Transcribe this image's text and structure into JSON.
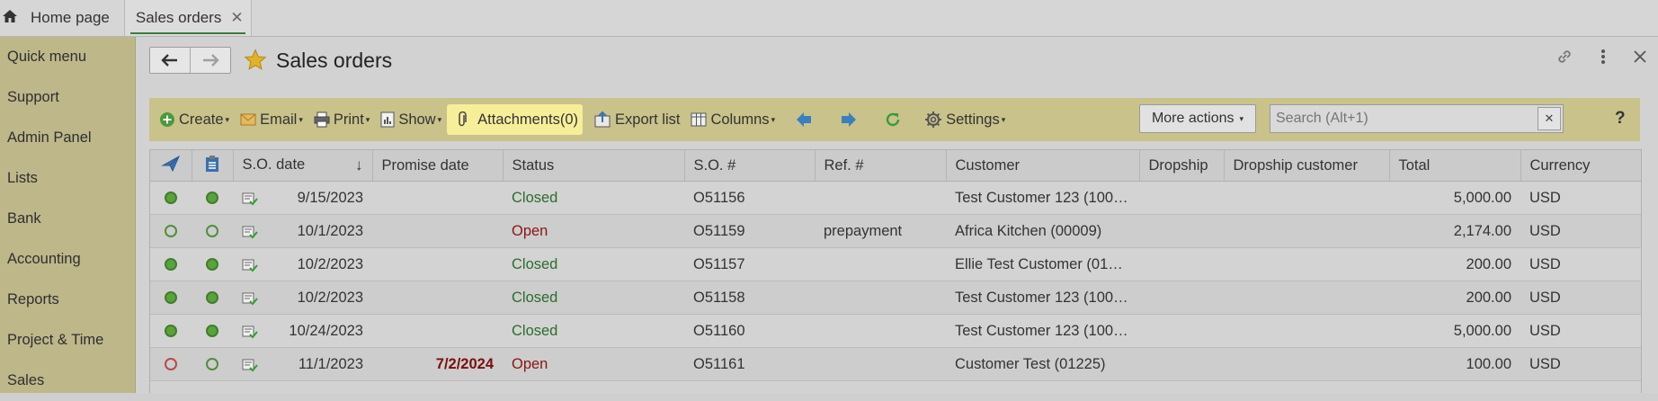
{
  "tabs": {
    "home_label": "Home page",
    "active_label": "Sales orders"
  },
  "sidebar": {
    "items": [
      {
        "label": "Quick menu"
      },
      {
        "label": "Support"
      },
      {
        "label": "Admin Panel"
      },
      {
        "label": "Lists"
      },
      {
        "label": "Bank"
      },
      {
        "label": "Accounting"
      },
      {
        "label": "Reports"
      },
      {
        "label": "Project & Time"
      },
      {
        "label": "Sales"
      }
    ]
  },
  "page": {
    "title": "Sales orders"
  },
  "toolbar": {
    "create": "Create",
    "email": "Email",
    "print": "Print",
    "show": "Show",
    "attachments": "Attachments(0)",
    "export": "Export list",
    "columns": "Columns",
    "settings": "Settings",
    "more_actions": "More actions",
    "search_placeholder": "Search (Alt+1)",
    "help": "?"
  },
  "table": {
    "columns": {
      "so_date": "S.O. date",
      "promise_date": "Promise date",
      "status": "Status",
      "so_number": "S.O. #",
      "ref": "Ref. #",
      "customer": "Customer",
      "dropship": "Dropship",
      "dropship_customer": "Dropship customer",
      "total": "Total",
      "currency": "Currency"
    },
    "rows": [
      {
        "so_date": "9/15/2023",
        "promise_date": "",
        "status": "Closed",
        "so_number": "O51156",
        "ref": "",
        "customer": "Test Customer 123 (100…",
        "total": "5,000.00",
        "currency": "USD"
      },
      {
        "so_date": "10/1/2023",
        "promise_date": "",
        "status": "Open",
        "so_number": "O51159",
        "ref": "prepayment",
        "customer": "Africa Kitchen (00009)",
        "total": "2,174.00",
        "currency": "USD"
      },
      {
        "so_date": "10/2/2023",
        "promise_date": "",
        "status": "Closed",
        "so_number": "O51157",
        "ref": "",
        "customer": "Ellie Test Customer (01…",
        "total": "200.00",
        "currency": "USD"
      },
      {
        "so_date": "10/2/2023",
        "promise_date": "",
        "status": "Closed",
        "so_number": "O51158",
        "ref": "",
        "customer": "Test Customer 123 (100…",
        "total": "200.00",
        "currency": "USD"
      },
      {
        "so_date": "10/24/2023",
        "promise_date": "",
        "status": "Closed",
        "so_number": "O51160",
        "ref": "",
        "customer": "Test Customer 123 (100…",
        "total": "5,000.00",
        "currency": "USD"
      },
      {
        "so_date": "11/1/2023",
        "promise_date": "7/2/2024",
        "status": "Open",
        "so_number": "O51161",
        "ref": "",
        "customer": "Customer Test (01225)",
        "total": "100.00",
        "currency": "USD"
      }
    ]
  },
  "colors": {
    "sidebar_bg": "#bdb78a",
    "toolbar_bg": "#c9c28a",
    "highlight": "#f7ee9a",
    "closed_status": "#2e6b2e",
    "open_status": "#8a1414"
  }
}
